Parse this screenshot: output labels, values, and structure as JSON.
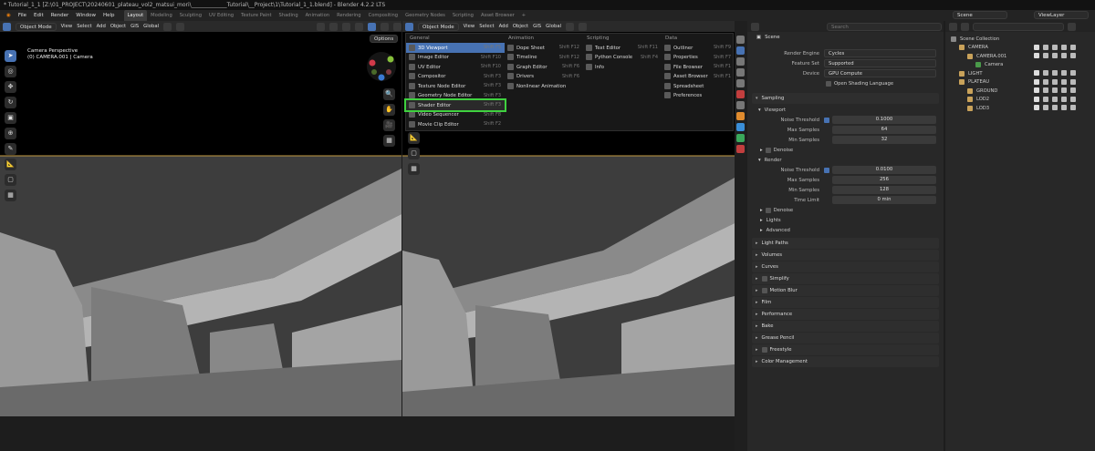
{
  "window_title": "* Tutorial_1_1 [Z:\\01_PROJECT\\20240601_plateau_vol2_matsui_mori\\_____________Tutorial\\__Project\\1\\Tutorial_1_1.blend] - Blender 4.2.2 LTS",
  "menubar": {
    "menus": [
      "File",
      "Edit",
      "Render",
      "Window",
      "Help"
    ],
    "workspaces": [
      "Layout",
      "Modeling",
      "Sculpting",
      "UV Editing",
      "Texture Paint",
      "Shading",
      "Animation",
      "Rendering",
      "Compositing",
      "Geometry Nodes",
      "Scripting",
      "Asset Browser"
    ],
    "active_workspace": "Layout",
    "scene": "Scene",
    "view_layer": "ViewLayer"
  },
  "left_viewport": {
    "mode": "Object Mode",
    "menus": [
      "View",
      "Select",
      "Add",
      "Object",
      "GIS"
    ],
    "transform": "Global",
    "options": "Options",
    "overlay_line1": "Camera Perspective",
    "overlay_line2": "(0) CAMERA.001 | Camera"
  },
  "right_viewport": {
    "mode": "Object Mode",
    "menus": [
      "View",
      "Select",
      "Add",
      "Object",
      "GIS"
    ],
    "transform": "Global"
  },
  "editor_menu": {
    "columns": [
      {
        "title": "General",
        "items": [
          {
            "label": "3D Viewport",
            "shortcut": "Shift F5",
            "highlight": true
          },
          {
            "label": "Image Editor",
            "shortcut": "Shift F10"
          },
          {
            "label": "UV Editor",
            "shortcut": "Shift F10"
          },
          {
            "label": "Compositor",
            "shortcut": "Shift F3"
          },
          {
            "label": "Texture Node Editor",
            "shortcut": "Shift F3"
          },
          {
            "label": "Geometry Node Editor",
            "shortcut": "Shift F3"
          },
          {
            "label": "Shader Editor",
            "shortcut": "Shift F3",
            "boxed": true
          },
          {
            "label": "Video Sequencer",
            "shortcut": "Shift F8"
          },
          {
            "label": "Movie Clip Editor",
            "shortcut": "Shift F2"
          }
        ]
      },
      {
        "title": "Animation",
        "items": [
          {
            "label": "Dope Sheet",
            "shortcut": "Shift F12"
          },
          {
            "label": "Timeline",
            "shortcut": "Shift F12"
          },
          {
            "label": "Graph Editor",
            "shortcut": "Shift F6"
          },
          {
            "label": "Drivers",
            "shortcut": "Shift F6"
          },
          {
            "label": "Nonlinear Animation",
            "shortcut": ""
          }
        ]
      },
      {
        "title": "Scripting",
        "items": [
          {
            "label": "Text Editor",
            "shortcut": "Shift F11"
          },
          {
            "label": "Python Console",
            "shortcut": "Shift F4"
          },
          {
            "label": "Info",
            "shortcut": ""
          }
        ]
      },
      {
        "title": "Data",
        "items": [
          {
            "label": "Outliner",
            "shortcut": "Shift F9"
          },
          {
            "label": "Properties",
            "shortcut": "Shift F7"
          },
          {
            "label": "File Browser",
            "shortcut": "Shift F1"
          },
          {
            "label": "Asset Browser",
            "shortcut": "Shift F1"
          },
          {
            "label": "Spreadsheet",
            "shortcut": ""
          },
          {
            "label": "Preferences",
            "shortcut": ""
          }
        ]
      }
    ]
  },
  "outliner": {
    "search_placeholder": "",
    "rows": [
      {
        "label": "Scene Collection",
        "indent": 0,
        "icons": false
      },
      {
        "label": "CAMERA",
        "indent": 1,
        "icons": true
      },
      {
        "label": "CAMERA.001",
        "indent": 2,
        "icons": true
      },
      {
        "label": "Camera",
        "indent": 3,
        "icons": false
      },
      {
        "label": "LIGHT",
        "indent": 1,
        "icons": true
      },
      {
        "label": "PLATEAU",
        "indent": 1,
        "icons": true
      },
      {
        "label": "GROUND",
        "indent": 2,
        "icons": true
      },
      {
        "label": "LOD2",
        "indent": 2,
        "icons": true
      },
      {
        "label": "LOD3",
        "indent": 2,
        "icons": true
      }
    ]
  },
  "properties": {
    "search_placeholder": "Search",
    "breadcrumb": "Scene",
    "render_engine": {
      "label": "Render Engine",
      "value": "Cycles"
    },
    "feature_set": {
      "label": "Feature Set",
      "value": "Supported"
    },
    "device": {
      "label": "Device",
      "value": "GPU Compute"
    },
    "osl": "Open Shading Language",
    "sampling": "Sampling",
    "viewport": "Viewport",
    "vp_noise": {
      "label": "Noise Threshold",
      "value": "0.1000"
    },
    "vp_max": {
      "label": "Max Samples",
      "value": "64"
    },
    "vp_min": {
      "label": "Min Samples",
      "value": "32"
    },
    "denoise1": "Denoise",
    "render": "Render",
    "r_noise": {
      "label": "Noise Threshold",
      "value": "0.0100"
    },
    "r_max": {
      "label": "Max Samples",
      "value": "256"
    },
    "r_min": {
      "label": "Min Samples",
      "value": "128"
    },
    "r_time": {
      "label": "Time Limit",
      "value": "0 min"
    },
    "denoise2": "Denoise",
    "lights": "Lights",
    "advanced": "Advanced",
    "panels": [
      "Light Paths",
      "Volumes",
      "Curves",
      "Simplify",
      "Motion Blur",
      "Film",
      "Performance",
      "Bake",
      "Grease Pencil",
      "Freestyle",
      "Color Management"
    ]
  },
  "colors": {
    "accent": "#4772b3",
    "highlight_box": "#3fd13f",
    "sky": "#3c3c3c"
  }
}
